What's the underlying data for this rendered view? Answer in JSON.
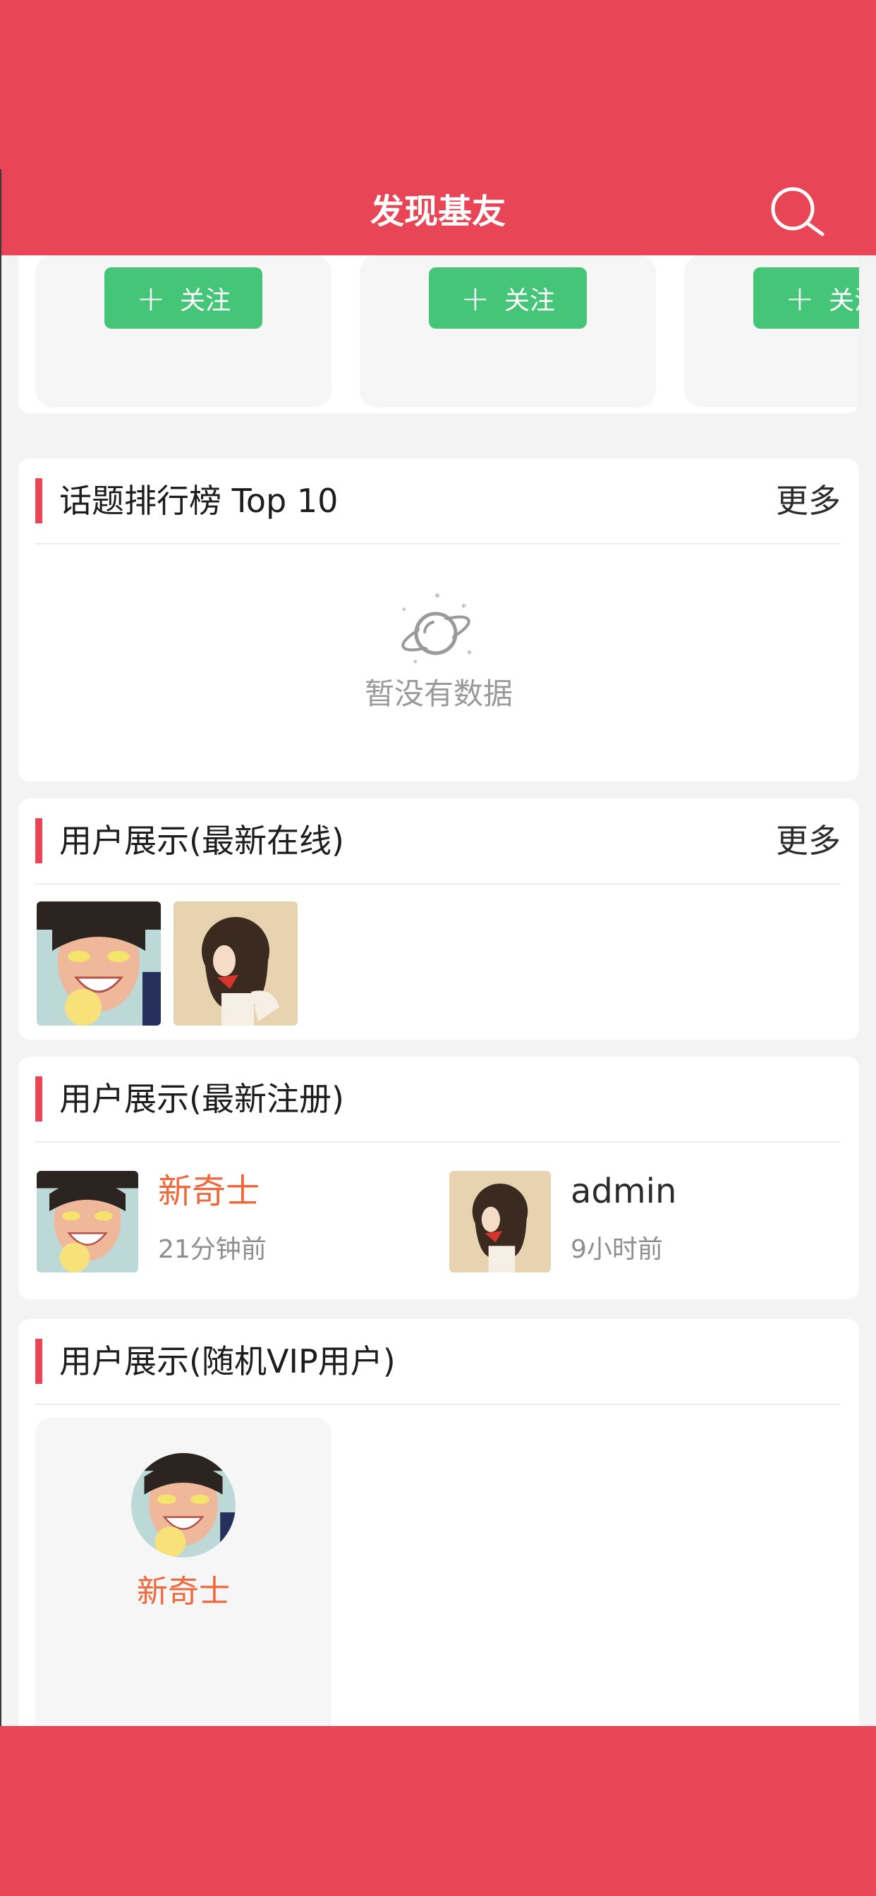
{
  "header": {
    "title": "发现基友",
    "search_icon": "search-icon"
  },
  "follow_strip": {
    "follow_label": "关注",
    "plus_icon": "plus-icon"
  },
  "topic_rank": {
    "title": "话题排行榜 Top 10",
    "more": "更多",
    "empty_text": "暂没有数据",
    "empty_icon": "planet-icon"
  },
  "online_users": {
    "title": "用户展示(最新在线)",
    "more": "更多"
  },
  "new_users": {
    "title": "用户展示(最新注册)",
    "users": [
      {
        "name": "新奇士",
        "time": "21分钟前"
      },
      {
        "name": "admin",
        "time": "9小时前"
      }
    ]
  },
  "vip_users": {
    "title": "用户展示(随机VIP用户)",
    "users": [
      {
        "name": "新奇士"
      }
    ]
  },
  "colors": {
    "brand": "#e84656",
    "follow_green": "#44c578",
    "accent_name": "#f0673a"
  }
}
